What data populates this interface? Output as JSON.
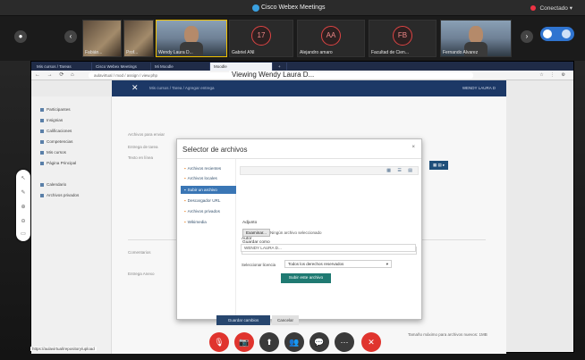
{
  "app": {
    "title": "Cisco Webex Meetings",
    "connection_status": "Conectado"
  },
  "participants": [
    {
      "name": "Fabián...",
      "kind": "photo"
    },
    {
      "name": "Prof..."
    },
    {
      "name": "Wendy Laura D...",
      "kind": "active"
    },
    {
      "name": "Gabriel ANI",
      "initials": "17"
    },
    {
      "name": "Alejandro amaro",
      "initials": "AA"
    },
    {
      "name": "Facultad de Cien...",
      "initials": "FB"
    },
    {
      "name": "Fernando Alvarez",
      "kind": "face"
    }
  ],
  "browser": {
    "tabs": [
      "Mis cursos / Tareas",
      "Cisco Webex Meetings",
      "Mi Moodle",
      "Moodle",
      "+"
    ],
    "url": "aulavirtual / mod / assign / view.php",
    "viewing": "Viewing Wendy Laura D..."
  },
  "moodle": {
    "header_title": "Mis cursos / Tarea / Agregar entrega",
    "user": "WENDY LAURA D"
  },
  "sidebar": {
    "items": [
      "Participantes",
      "Insignias",
      "Calificaciones",
      "Competencias",
      "Mis cursos",
      "Página Principal",
      "Calendario",
      "Archivos privados"
    ]
  },
  "background": {
    "lines": [
      "Archivos para enviar",
      "Entrega de tarea",
      "Texto en línea",
      "Comentarios",
      "Entrega Anexo"
    ],
    "submit": "Guardar cambios",
    "cancel": "Cancelar",
    "right_note": "Tamaño máximo para archivos nuevos: 1MB"
  },
  "modal": {
    "title": "Selector de archivos",
    "close": "×",
    "repos": [
      {
        "label": "Archivos recientes",
        "active": false
      },
      {
        "label": "Archivos locales",
        "active": false
      },
      {
        "label": "Subir un archivo",
        "active": true
      },
      {
        "label": "Descargador URL",
        "active": false
      },
      {
        "label": "Archivos privados",
        "active": false
      },
      {
        "label": "Wikimedia",
        "active": false
      }
    ],
    "adjunto_label": "Adjunto",
    "choose_file": "Examinar...",
    "no_file": "Ningún archivo seleccionado",
    "guardar_label": "Guardar como",
    "guardar_value": "",
    "autor_label": "Autor",
    "autor_value": "WENDY LAURA D...",
    "licencia_label": "Seleccionar licencia",
    "licencia_value": "Todos los derechos reservados",
    "upload_btn": "Subir este archivo"
  },
  "status_text": "https://aulavirtual/repository/upload",
  "controls": {
    "mute": "🎙",
    "video": "📷",
    "share": "⬆",
    "participants": "👥",
    "chat": "💬",
    "more": "⋯",
    "leave": "✕"
  }
}
